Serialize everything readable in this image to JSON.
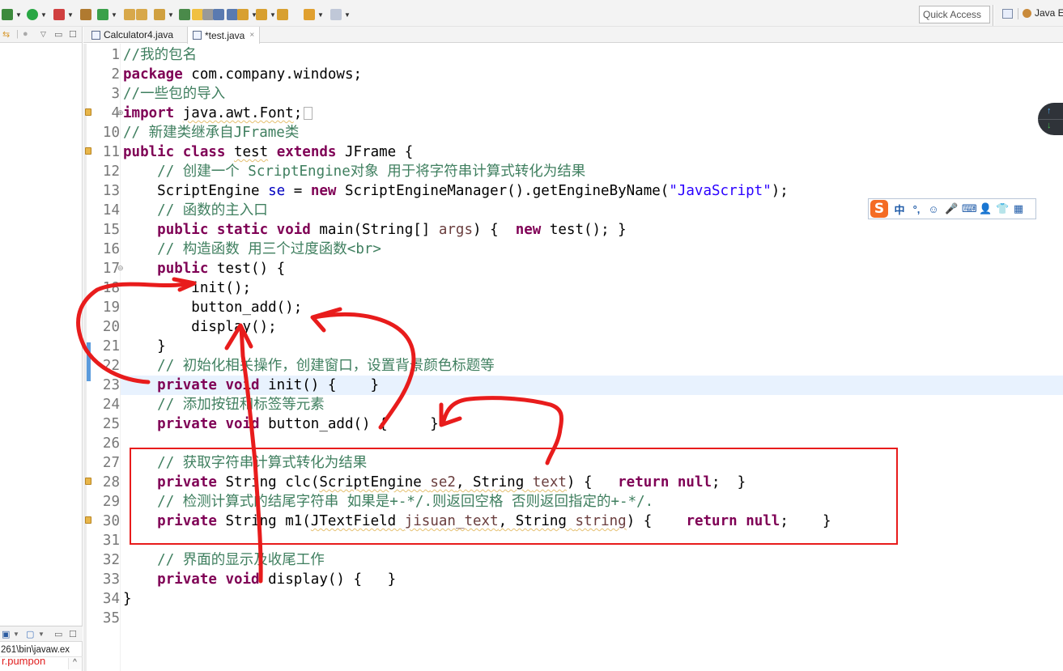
{
  "toolbar": {
    "items": [
      {
        "name": "debug",
        "color": "#3c8a3c"
      },
      {
        "name": "run",
        "color": "#29a744"
      },
      {
        "name": "run-external-tools",
        "color": "#d04040"
      },
      {
        "name": "new-java-package",
        "color": "#b07a30"
      },
      {
        "name": "new-java-class",
        "color": "#3aa04a"
      },
      {
        "name": "open-type",
        "color": "#d8a84a"
      },
      {
        "name": "open-task",
        "color": "#d8a84a"
      },
      {
        "name": "search",
        "color": "#d0a040"
      },
      {
        "name": "toggle-annotation",
        "color": "#4a8a4a"
      },
      {
        "name": "toggle-mark-occurrences",
        "color": "#f0c040"
      },
      {
        "name": "toggle-block-selection",
        "color": "#999999"
      },
      {
        "name": "toggle-breadcrumb",
        "color": "#5a7ab0"
      },
      {
        "name": "show-whitespace",
        "color": "#5a7ab0"
      },
      {
        "name": "next-annotation",
        "color": "#d8a030"
      },
      {
        "name": "previous-annotation",
        "color": "#d8a030"
      },
      {
        "name": "last-edit-location",
        "color": "#d8a030"
      },
      {
        "name": "back",
        "color": "#e0a030"
      },
      {
        "name": "forward",
        "color": "#c0c8d8"
      }
    ],
    "quick_access_placeholder": "Quick Access",
    "perspective_label": "Java E"
  },
  "left_view": {
    "console_path": "261\\bin\\javaw.ex",
    "console_output": "r.pumpon"
  },
  "editor_tabs": [
    {
      "label": "Calculator4.java",
      "active": false
    },
    {
      "label": "*test.java",
      "active": true,
      "close": "×"
    }
  ],
  "code_lines": [
    {
      "num": "1",
      "tokens": [
        {
          "t": "cm",
          "v": "//我的包名"
        }
      ]
    },
    {
      "num": "2",
      "tokens": [
        {
          "t": "kw",
          "v": "package"
        },
        {
          "t": "",
          "v": " com.company.windows;"
        }
      ]
    },
    {
      "num": "3",
      "tokens": [
        {
          "t": "cm",
          "v": "//一些包的导入"
        }
      ]
    },
    {
      "num": "4",
      "marker": "warning",
      "fold": "expand",
      "tokens": [
        {
          "t": "kw",
          "v": "import"
        },
        {
          "t": "",
          "v": " "
        },
        {
          "t": "warn",
          "v": "java.awt.Font"
        },
        {
          "t": "",
          "v": ";"
        },
        {
          "t": "box",
          "v": " "
        }
      ]
    },
    {
      "num": "10",
      "tokens": [
        {
          "t": "cm",
          "v": "// 新建类继承自JFrame类"
        }
      ]
    },
    {
      "num": "11",
      "marker": "warning",
      "tokens": [
        {
          "t": "kw",
          "v": "public class"
        },
        {
          "t": "",
          "v": " "
        },
        {
          "t": "warn",
          "v": "test"
        },
        {
          "t": "",
          "v": " "
        },
        {
          "t": "kw",
          "v": "extends"
        },
        {
          "t": "",
          "v": " JFrame {"
        }
      ]
    },
    {
      "num": "12",
      "tokens": [
        {
          "t": "",
          "v": "    "
        },
        {
          "t": "cm",
          "v": "// 创建一个 ScriptEngine对象 用于将字符串计算式转化为结果"
        }
      ]
    },
    {
      "num": "13",
      "tokens": [
        {
          "t": "",
          "v": "    ScriptEngine "
        },
        {
          "t": "fld",
          "v": "se"
        },
        {
          "t": "",
          "v": " = "
        },
        {
          "t": "kw",
          "v": "new"
        },
        {
          "t": "",
          "v": " ScriptEngineManager().getEngineByName("
        },
        {
          "t": "str",
          "v": "\"JavaScript\""
        },
        {
          "t": "",
          "v": ");"
        }
      ]
    },
    {
      "num": "14",
      "tokens": [
        {
          "t": "",
          "v": "    "
        },
        {
          "t": "cm",
          "v": "// 函数的主入口"
        }
      ]
    },
    {
      "num": "15",
      "tokens": [
        {
          "t": "",
          "v": "    "
        },
        {
          "t": "kw",
          "v": "public static void"
        },
        {
          "t": "",
          "v": " main(String[] "
        },
        {
          "t": "param",
          "v": "args"
        },
        {
          "t": "",
          "v": ") {  "
        },
        {
          "t": "kw",
          "v": "new"
        },
        {
          "t": "",
          "v": " test(); }"
        }
      ]
    },
    {
      "num": "16",
      "tokens": [
        {
          "t": "",
          "v": "    "
        },
        {
          "t": "cm",
          "v": "// 构造函数 用三个过度函数<br>"
        }
      ]
    },
    {
      "num": "17",
      "fold": "collapse",
      "tokens": [
        {
          "t": "",
          "v": "    "
        },
        {
          "t": "kw",
          "v": "public"
        },
        {
          "t": "",
          "v": " test() {"
        }
      ]
    },
    {
      "num": "18",
      "tokens": [
        {
          "t": "",
          "v": "        init();"
        }
      ]
    },
    {
      "num": "19",
      "tokens": [
        {
          "t": "",
          "v": "        button_add();"
        }
      ]
    },
    {
      "num": "20",
      "tokens": [
        {
          "t": "",
          "v": "        display();"
        }
      ]
    },
    {
      "num": "21",
      "tokens": [
        {
          "t": "",
          "v": "    }"
        }
      ]
    },
    {
      "num": "22",
      "tokens": [
        {
          "t": "",
          "v": "    "
        },
        {
          "t": "cm",
          "v": "// 初始化相关操作，创建窗口，设置背景颜色标题等"
        }
      ]
    },
    {
      "num": "23",
      "current": true,
      "tokens": [
        {
          "t": "",
          "v": "    "
        },
        {
          "t": "kw",
          "v": "private void"
        },
        {
          "t": "",
          "v": " init() {    }"
        }
      ]
    },
    {
      "num": "24",
      "tokens": [
        {
          "t": "",
          "v": "    "
        },
        {
          "t": "cm",
          "v": "// 添加按钮和标签等元素"
        }
      ]
    },
    {
      "num": "25",
      "tokens": [
        {
          "t": "",
          "v": "    "
        },
        {
          "t": "kw",
          "v": "private void"
        },
        {
          "t": "",
          "v": " button_add() {     }"
        }
      ]
    },
    {
      "num": "26",
      "tokens": []
    },
    {
      "num": "27",
      "tokens": [
        {
          "t": "",
          "v": "    "
        },
        {
          "t": "cm",
          "v": "// 获取字符串计算式转化为结果"
        }
      ]
    },
    {
      "num": "28",
      "marker": "warning",
      "tokens": [
        {
          "t": "",
          "v": "    "
        },
        {
          "t": "kw",
          "v": "private"
        },
        {
          "t": "",
          "v": " String clc("
        },
        {
          "t": "warn",
          "v": "ScriptEngine "
        },
        {
          "t": "warnparam",
          "v": "se2"
        },
        {
          "t": "warn",
          "v": ", String "
        },
        {
          "t": "warnparam",
          "v": "text"
        },
        {
          "t": "",
          "v": ") {   "
        },
        {
          "t": "kw",
          "v": "return null"
        },
        {
          "t": "",
          "v": ";  }"
        }
      ]
    },
    {
      "num": "29",
      "tokens": [
        {
          "t": "",
          "v": "    "
        },
        {
          "t": "cm",
          "v": "// 检测计算式的结尾字符串 如果是+-*/.则返回空格 否则返回指定的+-*/."
        }
      ]
    },
    {
      "num": "30",
      "marker": "warning",
      "tokens": [
        {
          "t": "",
          "v": "    "
        },
        {
          "t": "kw",
          "v": "private"
        },
        {
          "t": "",
          "v": " String m1("
        },
        {
          "t": "warn",
          "v": "JTextField "
        },
        {
          "t": "warnparam",
          "v": "jisuan_text"
        },
        {
          "t": "warn",
          "v": ", String "
        },
        {
          "t": "warnparam",
          "v": "string"
        },
        {
          "t": "",
          "v": ") {    "
        },
        {
          "t": "kw",
          "v": "return null"
        },
        {
          "t": "",
          "v": ";    }"
        }
      ]
    },
    {
      "num": "31",
      "tokens": []
    },
    {
      "num": "32",
      "tokens": [
        {
          "t": "",
          "v": "    "
        },
        {
          "t": "cm",
          "v": "// 界面的显示及收尾工作"
        }
      ]
    },
    {
      "num": "33",
      "tokens": [
        {
          "t": "",
          "v": "    "
        },
        {
          "t": "kw",
          "v": "private void"
        },
        {
          "t": "",
          "v": " display() {   }"
        }
      ]
    },
    {
      "num": "34",
      "tokens": [
        {
          "t": "",
          "v": "}"
        }
      ]
    },
    {
      "num": "35",
      "tokens": []
    }
  ],
  "ime_bar": {
    "logo": "S",
    "items": [
      "中",
      "°,",
      "☺",
      "🎤",
      "⌨",
      "👤",
      "👕",
      "▦"
    ]
  },
  "nav_float": {
    "up": "↑",
    "down": "↓"
  },
  "annotation_color": "#e81c1c"
}
